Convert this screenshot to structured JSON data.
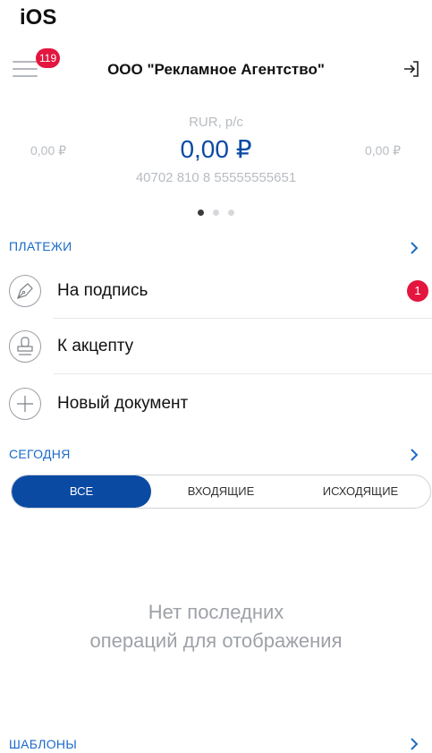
{
  "platform_label": "iOS",
  "header": {
    "notification_count": "119",
    "title": "ООО \"Рекламное Агентство\"",
    "menu_icon": "hamburger-menu-icon",
    "logout_icon": "logout-arrow-icon"
  },
  "account": {
    "left_amount": "0,00 ₽",
    "type": "RUR, р/с",
    "amount": "0,00 ₽",
    "number": "40702 810 8 55555555651",
    "right_amount": "0,00 ₽",
    "pages": 3,
    "active_page": 1
  },
  "payments": {
    "section_title": "ПЛАТЕЖИ",
    "items": [
      {
        "label": "На подпись",
        "icon": "pen-nib-icon",
        "badge": "1"
      },
      {
        "label": "К акцепту",
        "icon": "stamp-icon",
        "badge": ""
      },
      {
        "label": "Новый документ",
        "icon": "plus-icon",
        "badge": ""
      }
    ]
  },
  "today": {
    "section_title": "СЕГОДНЯ",
    "tabs": [
      {
        "label": "ВСЕ",
        "active": true
      },
      {
        "label": "ВХОДЯЩИЕ",
        "active": false
      },
      {
        "label": "ИСХОДЯЩИЕ",
        "active": false
      }
    ],
    "empty_line1": "Нет последних",
    "empty_line2": "операций для отображения"
  },
  "templates": {
    "section_title": "ШАБЛОНЫ"
  },
  "colors": {
    "accent": "#0b4aa3",
    "link": "#1c6ac8",
    "badge": "#e3163f"
  }
}
